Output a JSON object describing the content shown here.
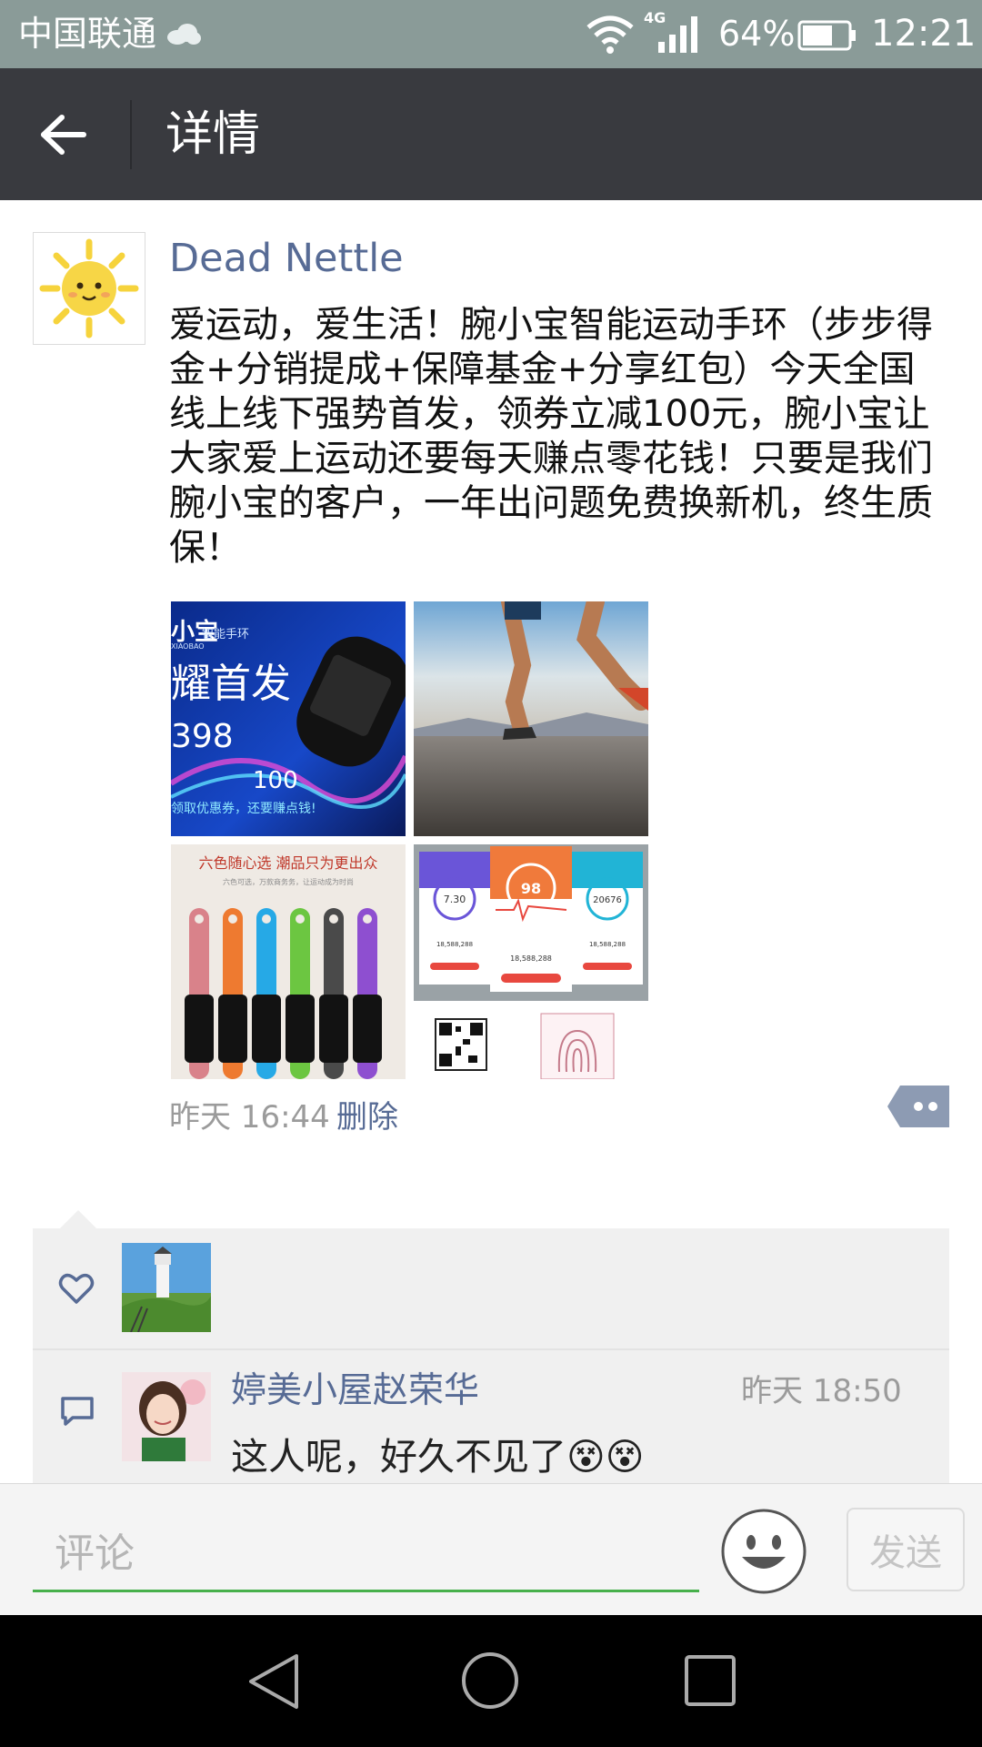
{
  "status_bar": {
    "carrier": "中国联通",
    "network": "4G",
    "battery_percent": "64%",
    "time": "12:21"
  },
  "header": {
    "title": "详情"
  },
  "post": {
    "author": "Dead Nettle",
    "text": "爱运动，爱生活！腕小宝智能运动手环（步步得金+分销提成+保障基金+分享红包）今天全国线上线下强势首发，领券立减100元，腕小宝让大家爱上运动还要每天赚点零花钱！只要是我们腕小宝的客户，一年出问题免费换新机，终生质保！",
    "images": [
      {
        "brand": "小宝",
        "subtitle": "智能手环",
        "latin": "XIAOBAO",
        "headline": "耀首发",
        "price": "398",
        "coupon": "100",
        "tagline": "领取优惠券，还要赚点钱!"
      },
      {
        "kind": "runner-photo"
      },
      {
        "headline": "六色随心选 潮品只为更出众",
        "subline": "六色可选，万款商务务，让运动成为时尚"
      },
      {
        "metrics": [
          "7.30",
          "98",
          "20676"
        ],
        "totals": [
          "18,588,288",
          "18,588,288",
          "18,588,288"
        ]
      }
    ],
    "timestamp": "昨天 16:44",
    "delete_label": "删除"
  },
  "comments": [
    {
      "author": "婷美小屋赵荣华",
      "time": "昨天 18:50",
      "text": "这人呢，好久不见了",
      "emojis": "😵😵"
    }
  ],
  "input": {
    "placeholder": "评论",
    "send_label": "发送"
  },
  "colors": {
    "header_bg": "#393a3f",
    "link": "#576b95",
    "accent_green": "#47b04b",
    "status_bar_bg": "#8a9b98"
  }
}
